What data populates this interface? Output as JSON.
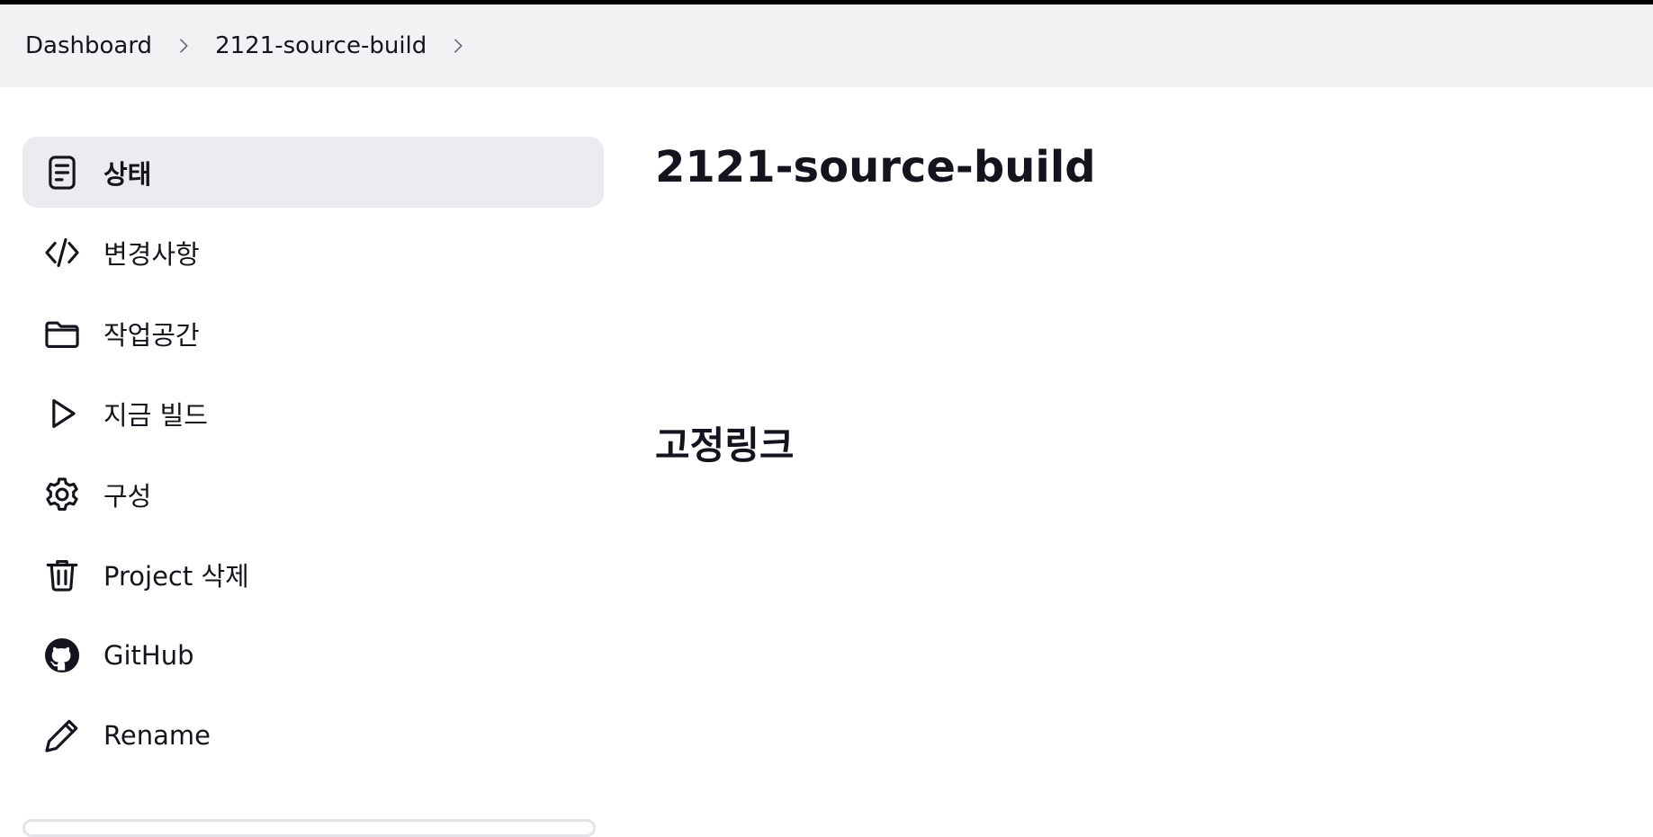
{
  "breadcrumb": {
    "items": [
      {
        "label": "Dashboard"
      },
      {
        "label": "2121-source-build"
      }
    ]
  },
  "sidebar": {
    "items": [
      {
        "label": "상태",
        "icon": "document-icon",
        "active": true
      },
      {
        "label": "변경사항",
        "icon": "code-icon",
        "active": false
      },
      {
        "label": "작업공간",
        "icon": "folder-icon",
        "active": false
      },
      {
        "label": "지금 빌드",
        "icon": "play-icon",
        "active": false
      },
      {
        "label": "구성",
        "icon": "gear-icon",
        "active": false
      },
      {
        "label": "Project 삭제",
        "icon": "trash-icon",
        "active": false
      },
      {
        "label": "GitHub",
        "icon": "github-icon",
        "active": false
      },
      {
        "label": "Rename",
        "icon": "pencil-icon",
        "active": false
      }
    ]
  },
  "main": {
    "title": "2121-source-build",
    "permalinks_heading": "고정링크"
  },
  "colors": {
    "text": "#14141f",
    "breadcrumb_bg": "#f2f2f4",
    "active_item_bg": "#ebebf0"
  }
}
